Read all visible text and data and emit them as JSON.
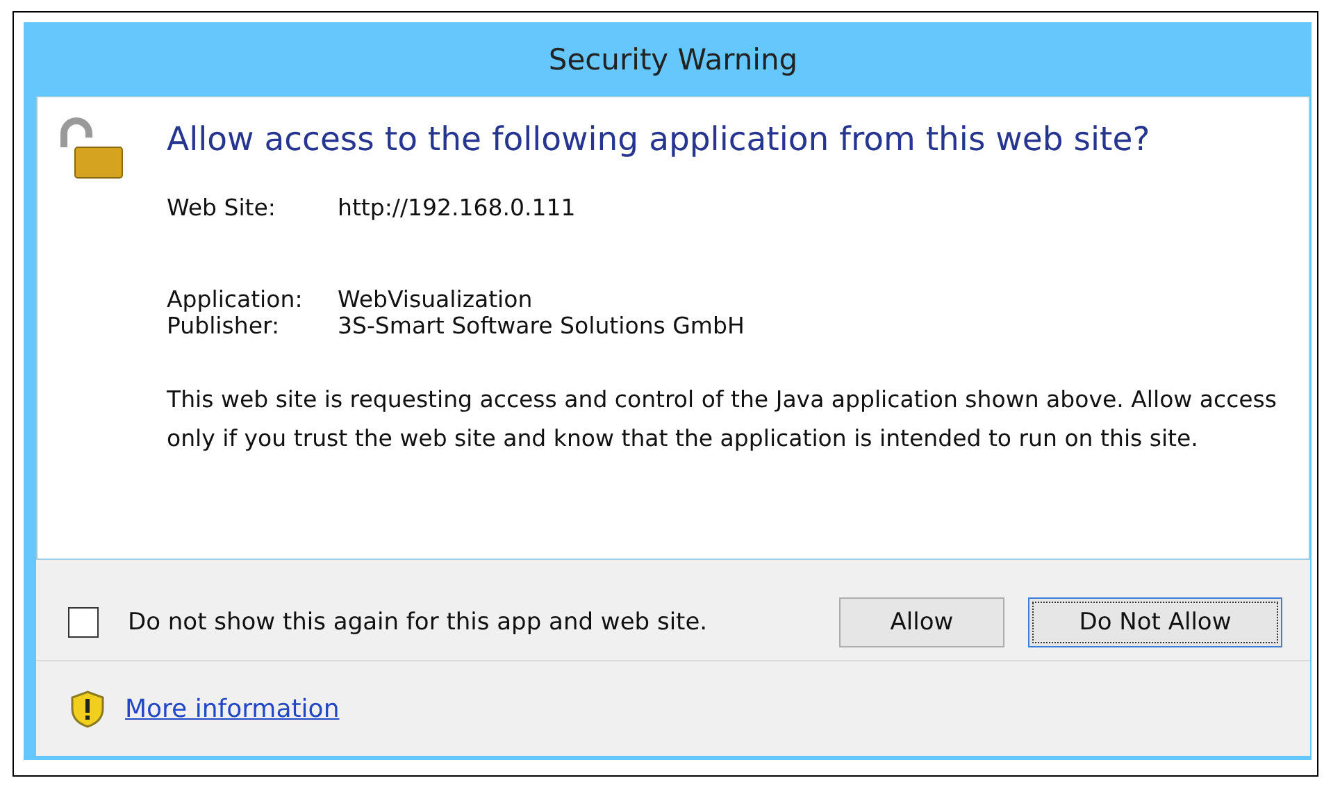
{
  "window": {
    "title": "Security Warning"
  },
  "heading": "Allow access to the following application from this web site?",
  "details": [
    {
      "label": "Web Site:",
      "value": "http://192.168.0.111"
    },
    {
      "label": "Application:",
      "value": "WebVisualization"
    },
    {
      "label": "Publisher:",
      "value": "3S-Smart Software Solutions GmbH"
    }
  ],
  "message": "This web site is requesting access and control of the Java application shown above. Allow access only if you trust the web site and know that the application is intended to run on this site.",
  "checkbox": {
    "label": "Do not show this again for this app and web site.",
    "checked": false
  },
  "buttons": [
    {
      "label": "Allow",
      "focused": false
    },
    {
      "label": "Do Not Allow",
      "focused": true
    }
  ],
  "link": "More information"
}
